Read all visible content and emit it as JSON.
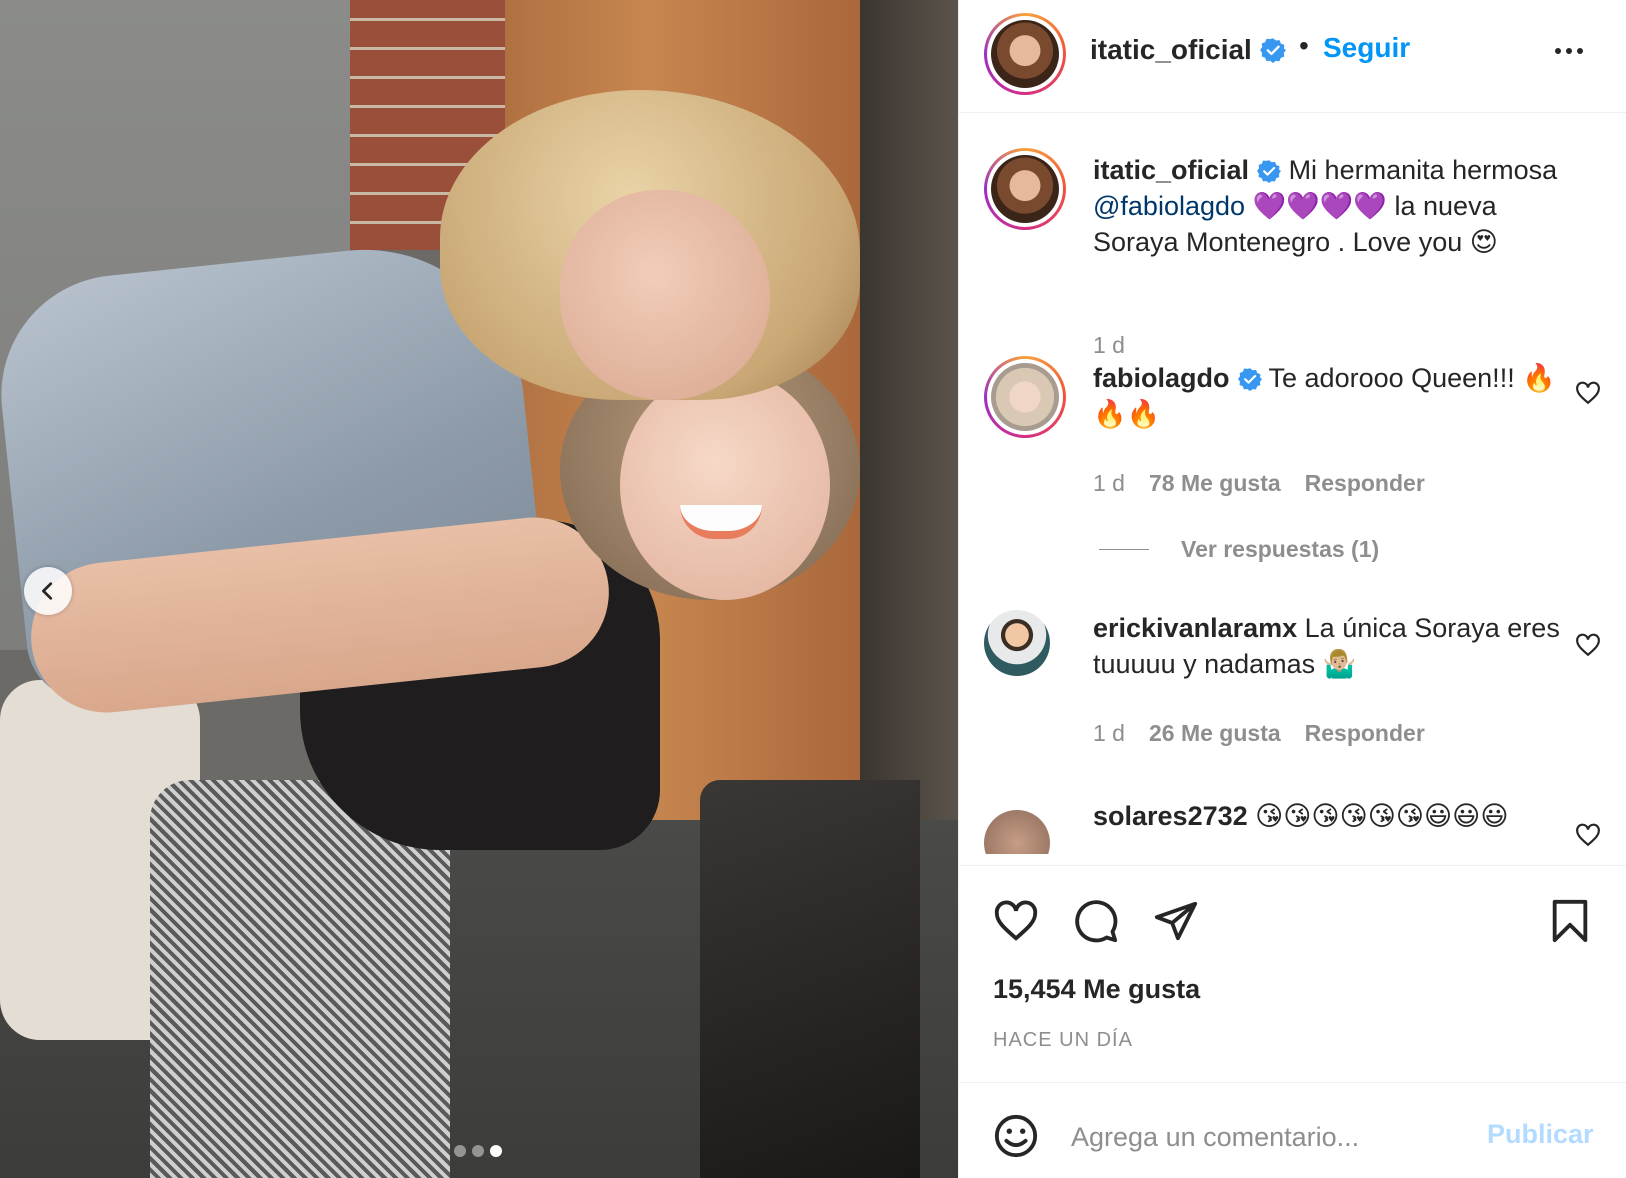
{
  "post": {
    "username": "itatic_oficial",
    "follow_label": "Seguir",
    "dot_separator": "•",
    "likes_count": "15,454 Me gusta",
    "timestamp": "HACE UN DÍA",
    "carousel": {
      "total_slides": 3,
      "active_index": 2
    }
  },
  "caption": {
    "username": "itatic_oficial",
    "text_before": " Mi hermanita hermosa ",
    "mention": "@fabiolagdo",
    "text_after": " 💜💜💜💜 la nueva Soraya Montenegro . Love you 😍",
    "age": "1 d"
  },
  "comments": [
    {
      "username": "fabiolagdo",
      "verified": true,
      "text": " Te adorooo Queen!!! 🔥🔥🔥",
      "age": "1 d",
      "likes": "78 Me gusta",
      "reply_label": "Responder",
      "view_replies": "Ver respuestas (1)"
    },
    {
      "username": "erickivanlaramx",
      "verified": false,
      "text": " La única Soraya eres tuuuuu y nadamas 🤷🏼‍♂️",
      "age": "1 d",
      "likes": "26 Me gusta",
      "reply_label": "Responder"
    },
    {
      "username": "solares2732",
      "verified": false,
      "text": " 😘😘😘😘😘😘😃😃😃"
    }
  ],
  "comment_box": {
    "placeholder": "Agrega un comentario...",
    "publish_label": "Publicar"
  },
  "colors": {
    "accent": "#0095f6",
    "publish_disabled": "#b3dbff",
    "verified_badge": "#3897f0",
    "muted_text": "#8e8e8e"
  },
  "icons": [
    "more-options-icon",
    "verified-icon",
    "heart-icon",
    "comment-icon",
    "share-icon",
    "save-icon",
    "emoji-icon",
    "chevron-left-icon"
  ]
}
